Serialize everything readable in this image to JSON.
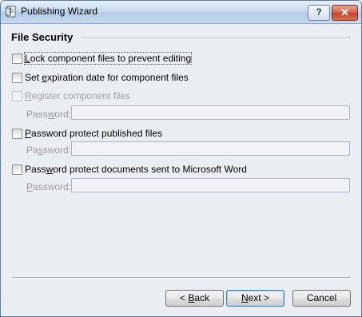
{
  "window": {
    "title": "Publishing Wizard",
    "help_glyph": "?",
    "close_glyph": "✕"
  },
  "section": {
    "title": "File Security"
  },
  "options": [
    {
      "pre": "",
      "key": "L",
      "post": "ock component files to prevent editing",
      "checked": false,
      "enabled": true
    },
    {
      "pre": "Set ",
      "key": "e",
      "post": "xpiration date for component files",
      "checked": false,
      "enabled": true
    },
    {
      "pre": "",
      "key": "R",
      "post": "egister component files",
      "checked": false,
      "enabled": false
    },
    {
      "pre": "",
      "key": "P",
      "post": "assword protect published files",
      "checked": false,
      "enabled": true
    },
    {
      "pre": "Pass",
      "key": "w",
      "post": "ord protect documents sent to Microsoft Word",
      "checked": false,
      "enabled": true
    }
  ],
  "password_fields": [
    {
      "pre": "Pass",
      "key": "w",
      "post": "ord:",
      "value": ""
    },
    {
      "pre": "Pa",
      "key": "s",
      "post": "sword:",
      "value": ""
    },
    {
      "pre": "",
      "key": "P",
      "post": "assword:",
      "value": ""
    }
  ],
  "buttons": {
    "back": {
      "pre": "< ",
      "key": "B",
      "post": "ack"
    },
    "next": {
      "pre": "",
      "key": "N",
      "post": "ext >"
    },
    "cancel": {
      "pre": "Cancel",
      "key": "",
      "post": ""
    }
  }
}
